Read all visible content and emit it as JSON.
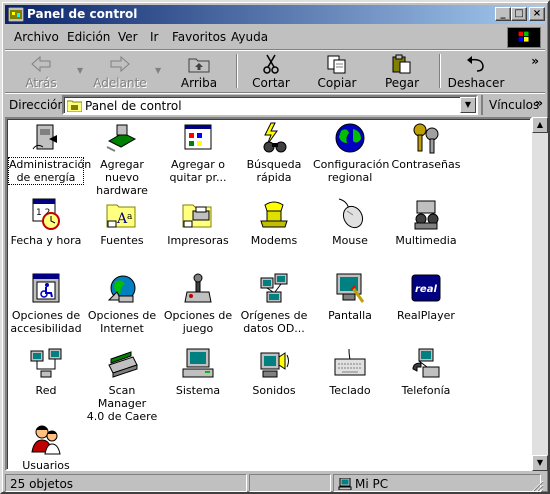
{
  "window": {
    "title": "Panel de control"
  },
  "title_buttons": {
    "minimize": "_",
    "maximize": "□",
    "close": "×"
  },
  "menu": [
    "Archivo",
    "Edición",
    "Ver",
    "Ir",
    "Favoritos",
    "Ayuda"
  ],
  "toolbar": {
    "back": "Atrás",
    "forward": "Adelante",
    "up": "Arriba",
    "cut": "Cortar",
    "copy": "Copiar",
    "paste": "Pegar",
    "undo": "Deshacer",
    "more": "»"
  },
  "address": {
    "label": "Dirección",
    "value": "Panel de control",
    "links": "Vínculos",
    "links_more": "»"
  },
  "items": [
    {
      "label1": "Administración",
      "label2": "de energía",
      "icon": "power-management-icon"
    },
    {
      "label1": "Agregar nuevo",
      "label2": "hardware",
      "icon": "add-hardware-icon"
    },
    {
      "label1": "Agregar o",
      "label2": "quitar pr...",
      "icon": "add-remove-programs-icon"
    },
    {
      "label1": "Búsqueda",
      "label2": "rápida",
      "icon": "quick-search-icon"
    },
    {
      "label1": "Configuración",
      "label2": "regional",
      "icon": "regional-settings-icon"
    },
    {
      "label1": "Contraseñas",
      "label2": "",
      "icon": "passwords-icon"
    },
    {
      "label1": "Fecha y hora",
      "label2": "",
      "icon": "date-time-icon"
    },
    {
      "label1": "Fuentes",
      "label2": "",
      "icon": "fonts-icon"
    },
    {
      "label1": "Impresoras",
      "label2": "",
      "icon": "printers-icon"
    },
    {
      "label1": "Modems",
      "label2": "",
      "icon": "modems-icon"
    },
    {
      "label1": "Mouse",
      "label2": "",
      "icon": "mouse-icon"
    },
    {
      "label1": "Multimedia",
      "label2": "",
      "icon": "multimedia-icon"
    },
    {
      "label1": "Opciones de",
      "label2": "accesibilidad",
      "icon": "accessibility-icon"
    },
    {
      "label1": "Opciones de",
      "label2": "Internet",
      "icon": "internet-options-icon"
    },
    {
      "label1": "Opciones de",
      "label2": "juego",
      "icon": "game-controllers-icon"
    },
    {
      "label1": "Orígenes de",
      "label2": "datos OD...",
      "icon": "odbc-data-sources-icon"
    },
    {
      "label1": "Pantalla",
      "label2": "",
      "icon": "display-icon"
    },
    {
      "label1": "RealPlayer",
      "label2": "",
      "icon": "realplayer-icon"
    },
    {
      "label1": "Red",
      "label2": "",
      "icon": "network-icon"
    },
    {
      "label1": "Scan Manager",
      "label2": "4.0 de Caere",
      "icon": "scanner-icon"
    },
    {
      "label1": "Sistema",
      "label2": "",
      "icon": "system-icon"
    },
    {
      "label1": "Sonidos",
      "label2": "",
      "icon": "sounds-icon"
    },
    {
      "label1": "Teclado",
      "label2": "",
      "icon": "keyboard-icon"
    },
    {
      "label1": "Telefonía",
      "label2": "",
      "icon": "telephony-icon"
    },
    {
      "label1": "Usuarios",
      "label2": "",
      "icon": "users-icon"
    }
  ],
  "status": {
    "count": "25 objetos",
    "zone": "Mi PC"
  },
  "colors": {
    "title_start": "#0a246a",
    "title_end": "#a6caf0",
    "face": "#c0c0c0"
  }
}
